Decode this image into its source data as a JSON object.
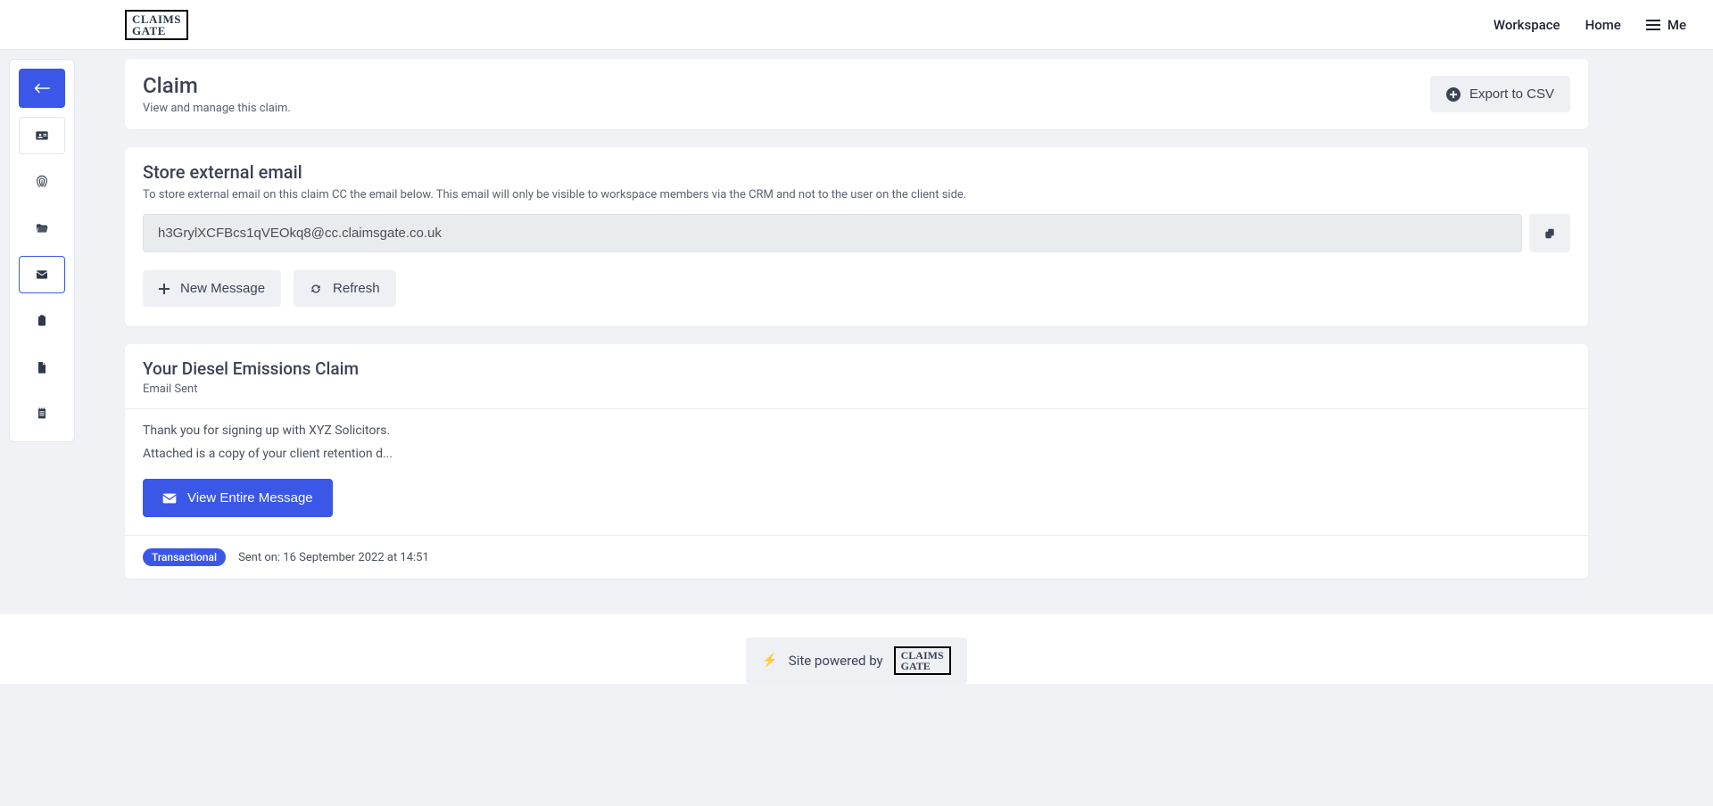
{
  "brand": {
    "line1": "CLAIMS",
    "line2": "GATE"
  },
  "topnav": {
    "workspace": "Workspace",
    "home": "Home",
    "me": "Me"
  },
  "claim_header": {
    "title": "Claim",
    "subtitle": "View and manage this claim.",
    "export_label": "Export to CSV"
  },
  "store_email": {
    "title": "Store external email",
    "description": "To store external email on this claim CC the email below. This email will only be visible to workspace members via the CRM and not to the user on the client side.",
    "value": "h3GrylXCFBcs1qVEOkq8@cc.claimsgate.co.uk",
    "new_message_label": "New Message",
    "refresh_label": "Refresh"
  },
  "message": {
    "title": "Your Diesel Emissions Claim",
    "status": "Email Sent",
    "body_line1": "Thank you for signing up with XYZ Solicitors.",
    "body_line2": "Attached is a copy of your client retention d...",
    "view_label": "View Entire Message",
    "badge": "Transactional",
    "sent_on": "Sent on: 16 September 2022 at 14:51"
  },
  "footer": {
    "powered_by": "Site powered by"
  }
}
